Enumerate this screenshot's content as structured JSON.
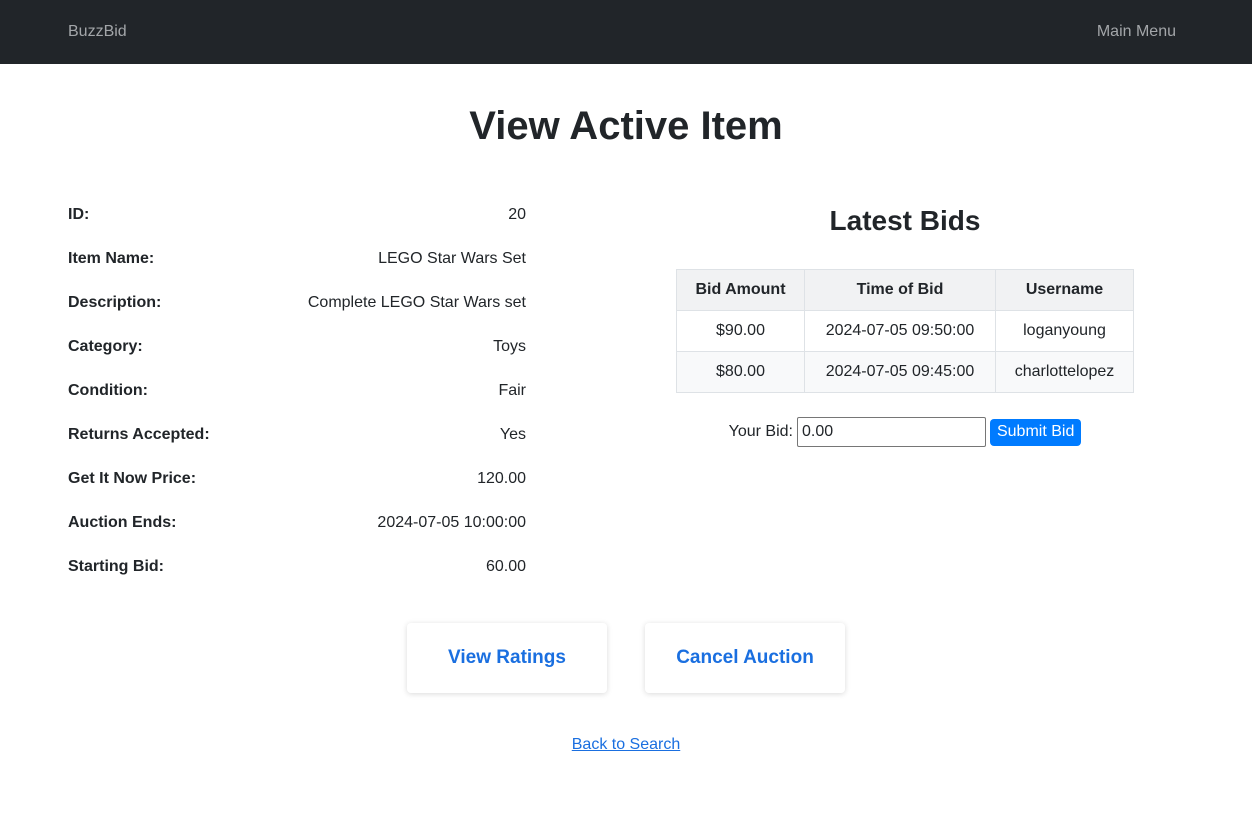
{
  "navbar": {
    "brand": "BuzzBid",
    "main_menu": "Main Menu"
  },
  "page": {
    "title": "View Active Item"
  },
  "item_details": [
    {
      "label": "ID:",
      "value": "20"
    },
    {
      "label": "Item Name:",
      "value": "LEGO Star Wars Set"
    },
    {
      "label": "Description:",
      "value": "Complete LEGO Star Wars set"
    },
    {
      "label": "Category:",
      "value": "Toys"
    },
    {
      "label": "Condition:",
      "value": "Fair"
    },
    {
      "label": "Returns Accepted:",
      "value": "Yes"
    },
    {
      "label": "Get It Now Price:",
      "value": "120.00"
    },
    {
      "label": "Auction Ends:",
      "value": "2024-07-05 10:00:00"
    },
    {
      "label": "Starting Bid:",
      "value": "60.00"
    }
  ],
  "bids": {
    "title": "Latest Bids",
    "headers": [
      "Bid Amount",
      "Time of Bid",
      "Username"
    ],
    "rows": [
      [
        "$90.00",
        "2024-07-05 09:50:00",
        "loganyoung"
      ],
      [
        "$80.00",
        "2024-07-05 09:45:00",
        "charlottelopez"
      ]
    ]
  },
  "bid_form": {
    "label": "Your Bid:",
    "value": "0.00",
    "submit_label": "Submit Bid"
  },
  "actions": {
    "view_ratings": "View Ratings",
    "cancel_auction": "Cancel Auction"
  },
  "back_link": "Back to Search",
  "colors": {
    "navbar_bg": "#212529",
    "accent": "#1a6fe0",
    "submit_bg": "#007bff"
  }
}
